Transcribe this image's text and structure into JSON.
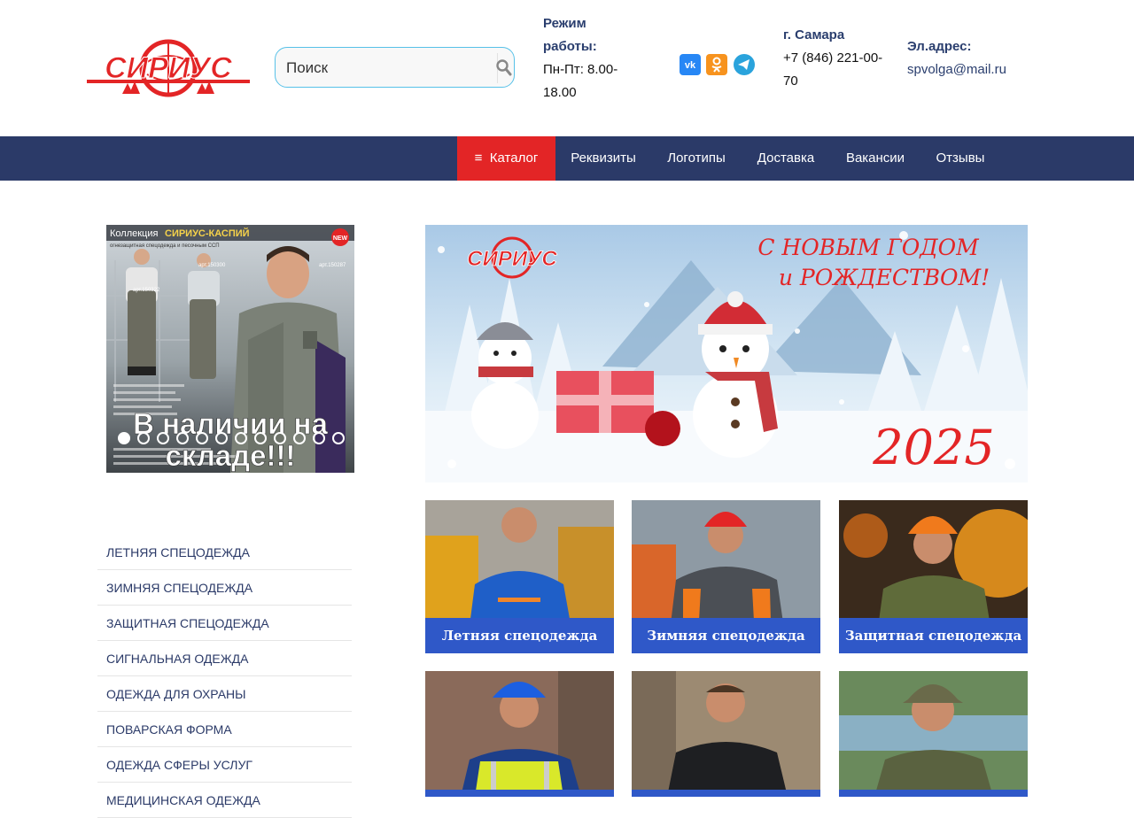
{
  "header": {
    "logo_text": "СИРИУС",
    "search": {
      "placeholder": "Поиск"
    },
    "hours": {
      "title_1": "Режим",
      "title_2": "работы:",
      "value_1": "Пн-Пт: 8.00-",
      "value_2": "18.00"
    },
    "city": {
      "title": "г. Самара",
      "phone_1": "+7 (846) 221-00-",
      "phone_2": "70"
    },
    "email": {
      "title": "Эл.адрес:",
      "value": "spvolga@mail.ru"
    },
    "social": [
      "vk-icon",
      "odnoklassniki-icon",
      "telegram-icon"
    ]
  },
  "nav": {
    "catalog_icon": "≡",
    "catalog": "Каталог",
    "items": [
      "Реквизиты",
      "Логотипы",
      "Доставка",
      "Вакансии",
      "Отзывы"
    ]
  },
  "promo": {
    "collection_label": "Коллекция",
    "collection_name": "СИРИУС-КАСПИЙ",
    "collection_sub": "огнезащитная спецодежда и песочным ССП",
    "badge": "NEW",
    "articles": [
      "арт.150322",
      "арт.150300",
      "арт.150287"
    ],
    "headline_1": "В наличии на",
    "headline_2": "складе!!!",
    "slider_dots": 12,
    "active_dot": 0
  },
  "categories": [
    "ЛЕТНЯЯ СПЕЦОДЕЖДА",
    "ЗИМНЯЯ СПЕЦОДЕЖДА",
    "ЗАЩИТНАЯ СПЕЦОДЕЖДА",
    "СИГНАЛЬНАЯ ОДЕЖДА",
    "ОДЕЖДА ДЛЯ ОХРАНЫ",
    "ПОВАРСКАЯ ФОРМА",
    "ОДЕЖДА СФЕРЫ УСЛУГ",
    "МЕДИЦИНСКАЯ ОДЕЖДА"
  ],
  "banner": {
    "logo": "СИРИУС",
    "greeting_1": "С НОВЫМ ГОДОМ",
    "greeting_2": "и РОЖДЕСТВОМ!",
    "year": "2025"
  },
  "tiles": [
    {
      "label": "Летняя спецодежда"
    },
    {
      "label": "Зимняя спецодежда"
    },
    {
      "label": "Защитная спецодежда"
    },
    {
      "label": ""
    },
    {
      "label": ""
    },
    {
      "label": ""
    }
  ],
  "colors": {
    "brand_red": "#e32526",
    "nav_blue": "#2b3a68",
    "tile_caption": "#2f58c8",
    "search_border": "#57c1e8"
  }
}
